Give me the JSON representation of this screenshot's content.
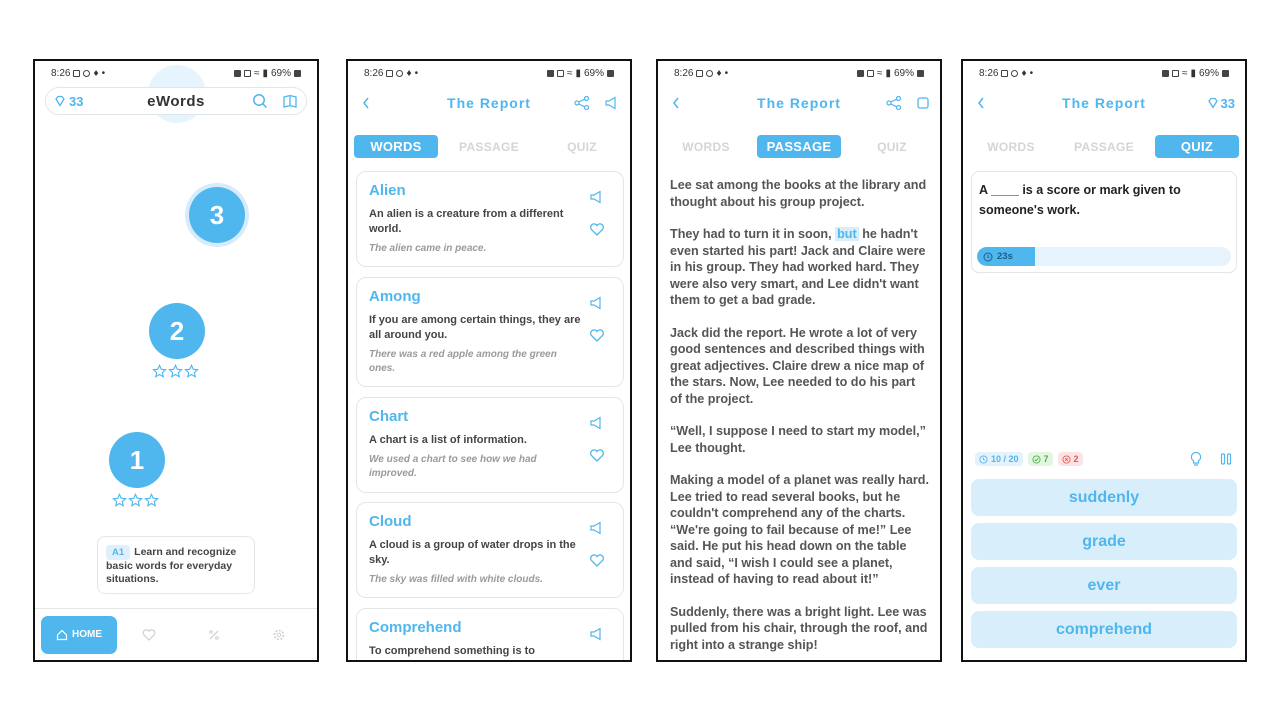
{
  "status": {
    "time": "8:26",
    "battery": "69%"
  },
  "screen1": {
    "gems": "33",
    "app_title": "eWords",
    "levels": [
      "1",
      "2",
      "3"
    ],
    "info_badge": "A1",
    "info_text": "Learn and recognize basic words for everyday situations.",
    "nav_home": "HOME"
  },
  "report": {
    "title": "The Report",
    "tabs": [
      "WORDS",
      "PASSAGE",
      "QUIZ"
    ]
  },
  "screen2": {
    "words": [
      {
        "word": "Alien",
        "definition": "An alien is a creature from a different world.",
        "example": "The alien came in peace."
      },
      {
        "word": "Among",
        "definition": "If you are among certain things, they are all around you.",
        "example": "There was a red apple among the green ones."
      },
      {
        "word": "Chart",
        "definition": "A chart is a list of information.",
        "example": "We used a chart to see how we had improved."
      },
      {
        "word": "Cloud",
        "definition": "A cloud is a group of water drops in the sky.",
        "example": "The sky was filled with white clouds."
      },
      {
        "word": "Comprehend",
        "definition": "To comprehend something is to",
        "example": ""
      }
    ]
  },
  "screen3": {
    "p1": "Lee sat among the books at the library and thought about his group project.",
    "p2_before": "They had to turn it in soon, ",
    "p2_highlight": "but",
    "p2_after": " he hadn't even started his part! Jack and Claire were in his group. They had worked hard. They were also very smart, and Lee didn't want them to get a bad grade.",
    "p3": "Jack did the report. He wrote a lot of very good sentences and described things with great adjectives. Claire drew a nice map of the stars. Now, Lee needed to do his part of the project.",
    "p4": "“Well, I suppose I need to start my model,” Lee thought.",
    "p5": "Making a model of a planet was really hard. Lee tried to read several books, but he couldn't comprehend any of the charts. “We're going to fail because of me!” Lee said. He put his head down on the table and said, “I wish I could see a planet, instead of having to read about it!”",
    "p6": "Suddenly, there was a bright light. Lee was pulled from his chair, through the roof, and right into a strange ship!"
  },
  "screen4": {
    "gems": "33",
    "question": "A ____ is a score or mark given to someone's work.",
    "timer": "23s",
    "timer_progress": 0.23,
    "progress": "10 / 20",
    "correct": "7",
    "wrong": "2",
    "answers": [
      "suddenly",
      "grade",
      "ever",
      "comprehend"
    ]
  },
  "colors": {
    "accent": "#4fb6ee",
    "accent_light": "#d9eefb"
  }
}
